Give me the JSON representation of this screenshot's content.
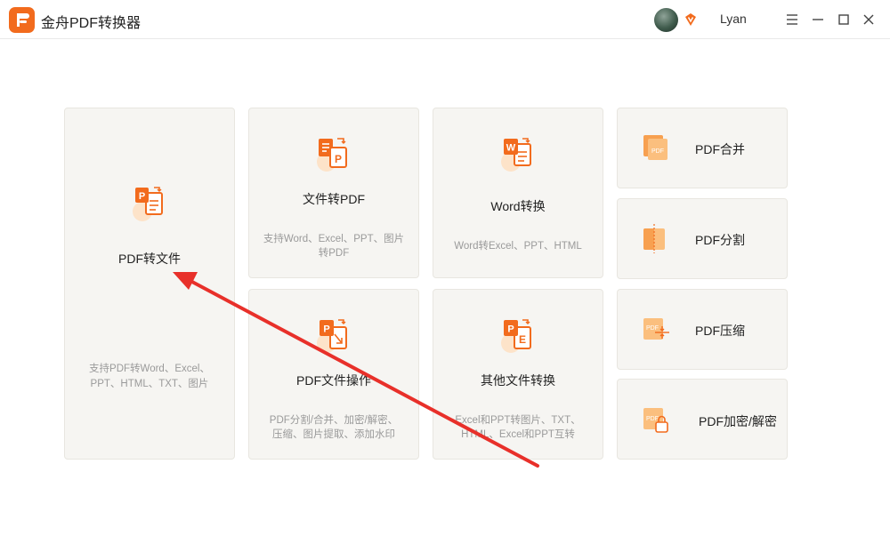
{
  "app": {
    "title": "金舟PDF转换器"
  },
  "user": {
    "name": "Lyan"
  },
  "cards": {
    "pdf_to_file": {
      "title": "PDF转文件",
      "desc_line1": "支持PDF转Word、Excel、",
      "desc_line2": "PPT、HTML、TXT、图片"
    },
    "file_to_pdf": {
      "title": "文件转PDF",
      "desc_line1": "支持Word、Excel、PPT、图片",
      "desc_line2": "转PDF"
    },
    "word_convert": {
      "title": "Word转换",
      "desc_line1": "Word转Excel、PPT、HTML"
    },
    "pdf_ops": {
      "title": "PDF文件操作",
      "desc_line1": "PDF分割/合并、加密/解密、",
      "desc_line2": "压缩、图片提取、添加水印"
    },
    "other_convert": {
      "title": "其他文件转换",
      "desc_line1": "Excel和PPT转图片、TXT、",
      "desc_line2": "HTML、Excel和PPT互转"
    },
    "pdf_merge": {
      "title": "PDF合并"
    },
    "pdf_split": {
      "title": "PDF分割"
    },
    "pdf_compress": {
      "title": "PDF压缩"
    },
    "pdf_encrypt": {
      "title": "PDF加密/解密"
    }
  },
  "icon_labels": {
    "P": "P",
    "W": "W",
    "E": "E",
    "PDF": "PDF"
  },
  "colors": {
    "accent": "#f26b1d",
    "light_accent": "#fbbf7e",
    "card_bg": "#f6f5f2",
    "annotation_arrow": "#e8302a"
  }
}
